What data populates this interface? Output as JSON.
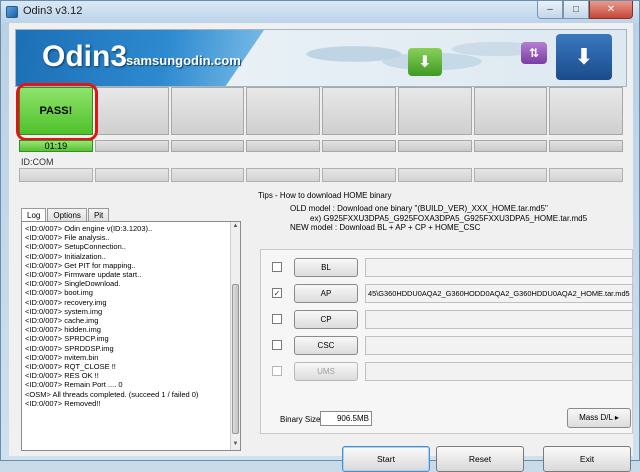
{
  "window": {
    "title": "Odin3 v3.12",
    "controls": [
      "–",
      "□",
      "✕"
    ]
  },
  "banner": {
    "brand": "Odin3",
    "brand_sub": "samsungodin.com"
  },
  "slots": {
    "status": "PASS!",
    "time": "01:19",
    "id_label": "ID:COM"
  },
  "tabs": [
    "Log",
    "Options",
    "Pit"
  ],
  "log": [
    "<ID:0/007> Odin engine v(ID:3.1203)..",
    "<ID:0/007> File analysis..",
    "<ID:0/007> SetupConnection..",
    "<ID:0/007> Initialzation..",
    "<ID:0/007> Get PIT for mapping..",
    "<ID:0/007> Firmware update start..",
    "<ID:0/007> SingleDownload.",
    "<ID:0/007> boot.img",
    "<ID:0/007> recovery.img",
    "<ID:0/007> system.img",
    "<ID:0/007> cache.img",
    "<ID:0/007> hidden.img",
    "<ID:0/007> SPRDCP.img",
    "<ID:0/007> SPRDDSP.img",
    "<ID:0/007> nvitem.bin",
    "<ID:0/007> RQT_CLOSE !!",
    "<ID:0/007> RES OK !!",
    "<ID:0/007> Remain Port .... 0",
    "<OSM> All threads completed. (succeed 1 / failed 0)",
    "<ID:0/007> Removed!!"
  ],
  "tips": {
    "title": "Tips - How to download HOME binary",
    "line1": "OLD model : Download one binary    \"(BUILD_VER)_XXX_HOME.tar.md5\"",
    "line2": "ex) G925FXXU3DPA5_G925FOXA3DPA5_G925FXXU3DPA5_HOME.tar.md5",
    "line3": "NEW model : Download BL + AP + CP + HOME_CSC"
  },
  "files": [
    {
      "label": "BL",
      "checked": false,
      "enabled": true,
      "path": ""
    },
    {
      "label": "AP",
      "checked": true,
      "enabled": true,
      "path": "45\\G360HDDU0AQA2_G360HODD0AQA2_G360HDDU0AQA2_HOME.tar.md5"
    },
    {
      "label": "CP",
      "checked": false,
      "enabled": true,
      "path": ""
    },
    {
      "label": "CSC",
      "checked": false,
      "enabled": true,
      "path": ""
    },
    {
      "label": "UMS",
      "checked": false,
      "enabled": false,
      "path": ""
    }
  ],
  "binary": {
    "label": "Binary Size",
    "value": "906.5MB"
  },
  "buttons": {
    "mass": "Mass D/L ▸",
    "start": "Start",
    "reset": "Reset",
    "exit": "Exit"
  }
}
